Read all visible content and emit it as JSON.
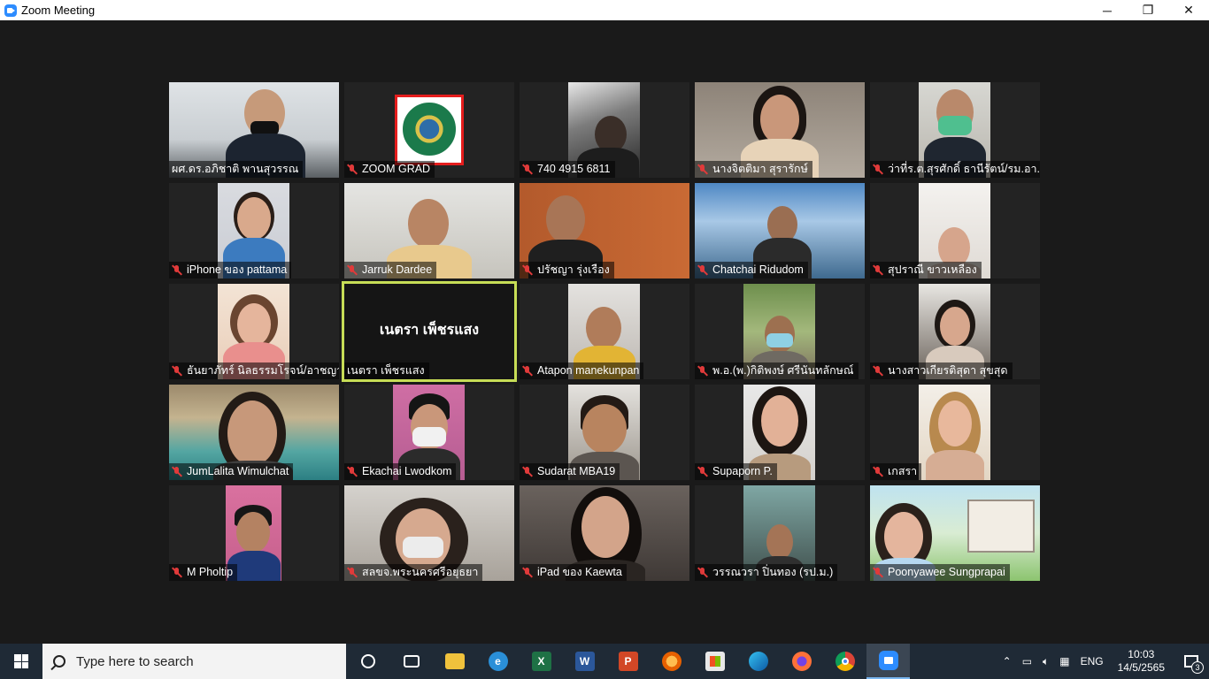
{
  "window": {
    "title": "Zoom Meeting",
    "minimize": "─",
    "restore": "❐",
    "close": "✕"
  },
  "participants": [
    {
      "name": "ผศ.ดร.อภิชาติ พานสุวรรณ"
    },
    {
      "name": "ZOOM GRAD"
    },
    {
      "name": "740 4915 6811"
    },
    {
      "name": "นางจิตติมา สุรารักษ์"
    },
    {
      "name": "ว่าที่ร.ต.สุรศักดิ์ ธานีรัตน์/รม.อา..."
    },
    {
      "name": "iPhone ของ pattama"
    },
    {
      "name": "Jarruk Dardee"
    },
    {
      "name": "ปรัชญา รุ่งเรือง"
    },
    {
      "name": "Chatchai Ridudom"
    },
    {
      "name": "สุปราณี ขาวเหลือง"
    },
    {
      "name": "ธันยาภัทร์ นิลธรรมโรจน์/อาชญา"
    },
    {
      "name": "เนตรา เพ็ชรแสง",
      "display_name": "เนตรา เพ็ชรแสง"
    },
    {
      "name": "Atapon manekunpan"
    },
    {
      "name": "พ.อ.(พ.)กิติพงษ์ ศรีนันทลักษณ์"
    },
    {
      "name": "นางสาวเกียรติสุดา สุขสุด"
    },
    {
      "name": "JumLalita Wimulchat"
    },
    {
      "name": "Ekachai Lwodkom"
    },
    {
      "name": "Sudarat MBA19"
    },
    {
      "name": "Supaporn P."
    },
    {
      "name": "เกสรา"
    },
    {
      "name": "M Pholtip"
    },
    {
      "name": "สลขจ.พระนครศรีอยุธยา"
    },
    {
      "name": "iPad ของ Kaewta"
    },
    {
      "name": "วรรณวรา ปิ่นทอง (รป.ม.)"
    },
    {
      "name": "Poonyawee Sungprapai"
    }
  ],
  "taskbar": {
    "search_placeholder": "Type here to search",
    "language": "ENG",
    "time": "10:03",
    "date": "14/5/2565",
    "notification_count": "3",
    "apps": [
      "Cortana",
      "Task View",
      "File Explorer",
      "Internet Explorer",
      "Excel",
      "Word",
      "PowerPoint",
      "Firefox",
      "Microsoft Store",
      "Edge",
      "Firefox",
      "Chrome",
      "Zoom"
    ]
  }
}
